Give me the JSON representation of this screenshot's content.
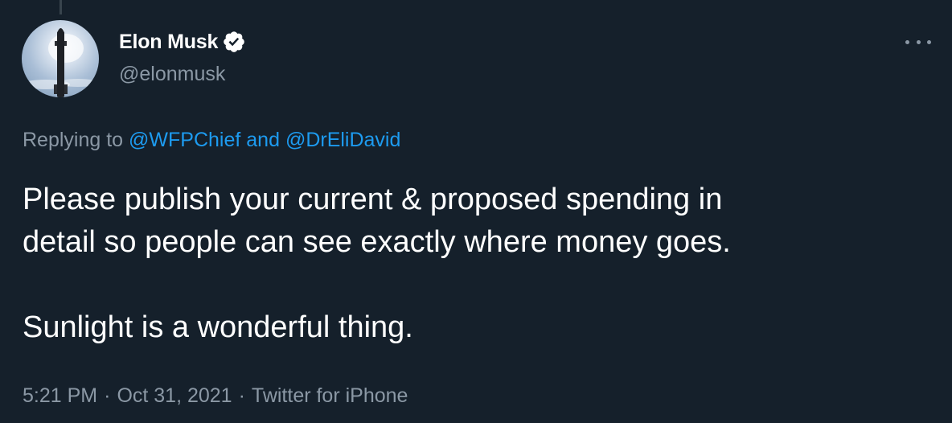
{
  "author": {
    "display_name": "Elon Musk",
    "handle": "@elonmusk",
    "verified": true
  },
  "reply": {
    "prefix": "Replying to ",
    "user1": "@WFPChief",
    "conjunction": " and ",
    "user2": "@DrEliDavid"
  },
  "tweet": {
    "line1": "Please publish your current & proposed spending in",
    "line2": "detail so people can see exactly where money goes.",
    "line3": "Sunlight is a wonderful thing."
  },
  "meta": {
    "time": "5:21 PM",
    "separator": "·",
    "date": "Oct 31, 2021",
    "source": "Twitter for iPhone"
  },
  "icons": {
    "verified": "verified-badge-icon",
    "more": "more-options-icon"
  },
  "colors": {
    "background": "#15202b",
    "text": "#ffffff",
    "secondary": "#8b98a5",
    "accent": "#1d9bf0"
  }
}
